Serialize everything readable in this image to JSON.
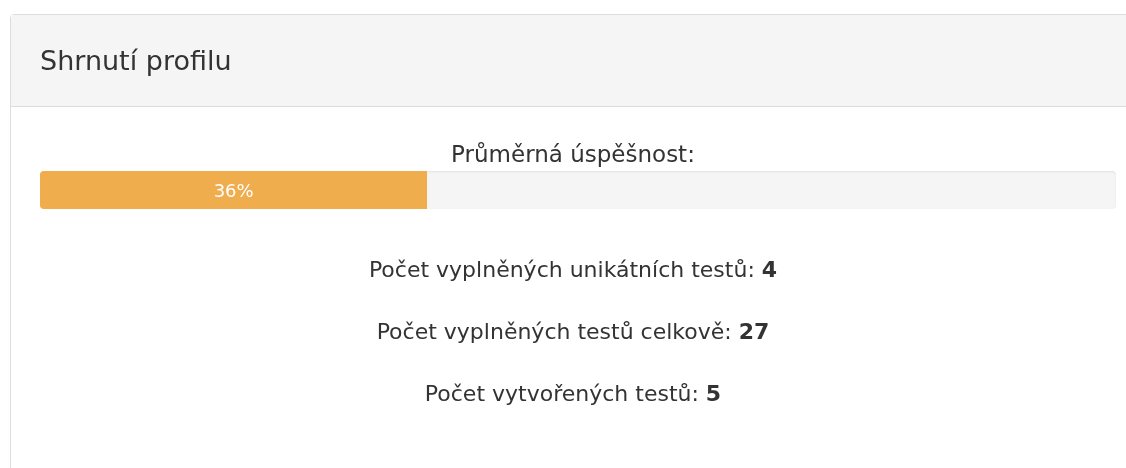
{
  "panel": {
    "title": "Shrnutí profilu"
  },
  "progress": {
    "label": "Průměrná úspěšnost:",
    "level": 0.36,
    "reading": "36%"
  },
  "stats": [
    "Počet vyplněných unikátních testů: **4**",
    "Počet vyplněných testů celkově: **27**",
    "Počet vytvořených testů: **5**"
  ]
}
